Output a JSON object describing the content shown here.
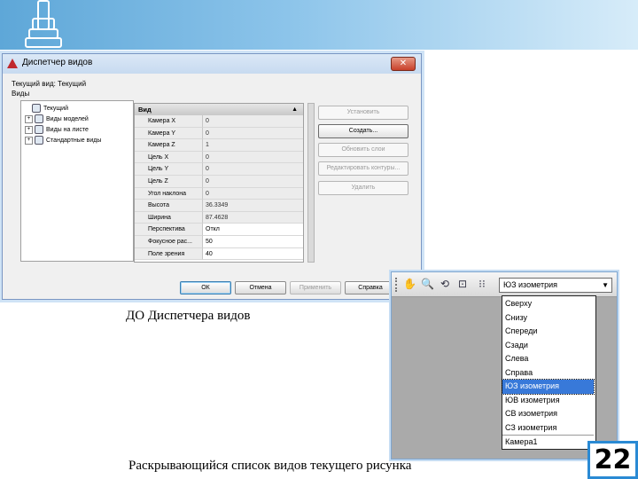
{
  "slide": {
    "caption_top": "ДО Диспетчера видов",
    "caption_bottom": "Раскрывающийся список видов текущего рисунка",
    "page_number": "22",
    "accent_color": "#2a8ad4"
  },
  "dialog": {
    "title": "Диспетчер видов",
    "close_label": "✕",
    "current_view_label": "Текущий вид: Текущий",
    "views_group_label": "Виды",
    "tree": [
      {
        "label": "Текущий",
        "expander": ""
      },
      {
        "label": "Виды моделей",
        "expander": "+"
      },
      {
        "label": "Виды на листе",
        "expander": "+"
      },
      {
        "label": "Стандартные виды",
        "expander": "+"
      }
    ],
    "properties": {
      "header": "Вид",
      "collapse_glyph": "▲",
      "rows": [
        {
          "key": "Камера X",
          "value": "0"
        },
        {
          "key": "Камера Y",
          "value": "0"
        },
        {
          "key": "Камера Z",
          "value": "1"
        },
        {
          "key": "Цель X",
          "value": "0"
        },
        {
          "key": "Цель Y",
          "value": "0"
        },
        {
          "key": "Цель Z",
          "value": "0"
        },
        {
          "key": "Угол наклона",
          "value": "0"
        },
        {
          "key": "Высота",
          "value": "36.3349"
        },
        {
          "key": "Ширина",
          "value": "87.4628"
        },
        {
          "key": "Перспектива",
          "value": "Откл"
        },
        {
          "key": "Фокусное рас...",
          "value": "50"
        },
        {
          "key": "Поле зрения",
          "value": "40"
        }
      ]
    },
    "side_buttons": [
      {
        "label": "Установить",
        "enabled": false
      },
      {
        "label": "Создать...",
        "enabled": true
      },
      {
        "label": "Обновить слои",
        "enabled": false
      },
      {
        "label": "Редактировать контуры...",
        "enabled": false
      },
      {
        "label": "Удалить",
        "enabled": false
      }
    ],
    "footer_buttons": {
      "ok": "ОК",
      "cancel": "Отмена",
      "apply": "Применить",
      "help": "Справка"
    }
  },
  "toolbar": {
    "icons": [
      "pan-hand-icon",
      "zoom-icon",
      "orbit-icon",
      "zoom-window-icon",
      "walk-icon"
    ],
    "combo_value": "ЮЗ изометрия",
    "combo_arrow": "▼",
    "options": [
      "Сверху",
      "Снизу",
      "Спереди",
      "Сзади",
      "Слева",
      "Справа",
      "ЮЗ изометрия",
      "ЮВ изометрия",
      "СВ изометрия",
      "СЗ изометрия",
      "Камера1"
    ],
    "selected_option": "ЮЗ изометрия"
  }
}
